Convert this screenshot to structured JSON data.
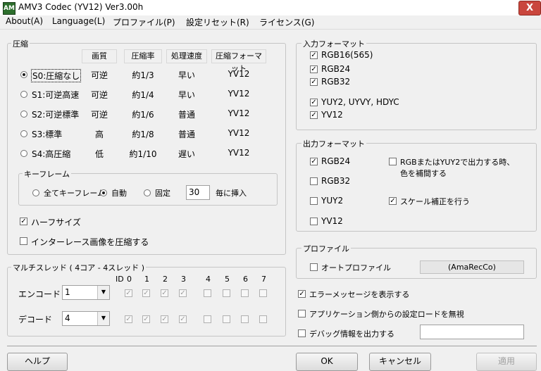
{
  "window": {
    "title": "AMV3 Codec (YV12) Ver3.00h",
    "close_glyph": "X",
    "icon_text": "AM"
  },
  "menu": [
    "About(A)",
    "Language(L)",
    "プロファイル(P)",
    "設定リセット(R)",
    "ライセンス(G)"
  ],
  "compression": {
    "group_title": "圧縮",
    "headers": [
      "画質",
      "圧縮率",
      "処理速度",
      "圧縮フォーマット"
    ],
    "rows": [
      {
        "label": "S0:圧縮なし",
        "quality": "可逆",
        "ratio": "約1/3",
        "speed": "早い",
        "format": "YV12",
        "selected": true
      },
      {
        "label": "S1:可逆高速",
        "quality": "可逆",
        "ratio": "約1/4",
        "speed": "早い",
        "format": "YV12",
        "selected": false
      },
      {
        "label": "S2:可逆標準",
        "quality": "可逆",
        "ratio": "約1/6",
        "speed": "普通",
        "format": "YV12",
        "selected": false
      },
      {
        "label": "S3:標準",
        "quality": "高",
        "ratio": "約1/8",
        "speed": "普通",
        "format": "YV12",
        "selected": false
      },
      {
        "label": "S4:高圧縮",
        "quality": "低",
        "ratio": "約1/10",
        "speed": "遅い",
        "format": "YV12",
        "selected": false
      }
    ]
  },
  "keyframe": {
    "group_title": "キーフレーム",
    "options": [
      "全てキーフレーム",
      "自動",
      "固定"
    ],
    "selected": "自動",
    "interval_value": "30",
    "suffix": "毎に挿入"
  },
  "half_size": {
    "label": "ハーフサイズ",
    "checked": true
  },
  "interlace": {
    "label": "インターレース画像を圧縮する",
    "checked": false
  },
  "multithread": {
    "group_title": "マルチスレッド ( 4コア - 4スレッド )",
    "id_header": "ID",
    "ids": [
      "0",
      "1",
      "2",
      "3",
      "4",
      "5",
      "6",
      "7"
    ],
    "encode": {
      "label": "エンコード",
      "value": "1",
      "checks": [
        true,
        true,
        true,
        true,
        false,
        false,
        false,
        false
      ]
    },
    "decode": {
      "label": "デコード",
      "value": "4",
      "checks": [
        true,
        true,
        true,
        true,
        false,
        false,
        false,
        false
      ]
    }
  },
  "input_format": {
    "group_title": "入力フォーマット",
    "items": [
      {
        "label": "RGB16(565)",
        "checked": true
      },
      {
        "label": "RGB24",
        "checked": true
      },
      {
        "label": "RGB32",
        "checked": true
      },
      {
        "label": "YUY2, UYVY, HDYC",
        "checked": true
      },
      {
        "label": "YV12",
        "checked": true
      }
    ]
  },
  "output_format": {
    "group_title": "出力フォーマット",
    "items": [
      {
        "label": "RGB24",
        "checked": true
      },
      {
        "label": "RGB32",
        "checked": false
      },
      {
        "label": "YUY2",
        "checked": false
      },
      {
        "label": "YV12",
        "checked": false
      }
    ],
    "color_correct": {
      "label_line1": "RGBまたはYUY2で出力する時、",
      "label_line2": "色を補間する",
      "checked": false
    },
    "scale_correct": {
      "label": "スケール補正を行う",
      "checked": true
    }
  },
  "profile": {
    "group_title": "プロファイル",
    "auto_label": "オートプロファイル",
    "auto_checked": false,
    "name": "(AmaRecCo)"
  },
  "options": {
    "show_errors": {
      "label": "エラーメッセージを表示する",
      "checked": true
    },
    "ignore_app_load": {
      "label": "アプリケーション側からの設定ロードを無視",
      "checked": false
    },
    "debug_output": {
      "label": "デバッグ情報を出力する",
      "checked": false,
      "value": ""
    }
  },
  "buttons": {
    "help": "ヘルプ",
    "ok": "OK",
    "cancel": "キャンセル",
    "apply": "適用"
  }
}
